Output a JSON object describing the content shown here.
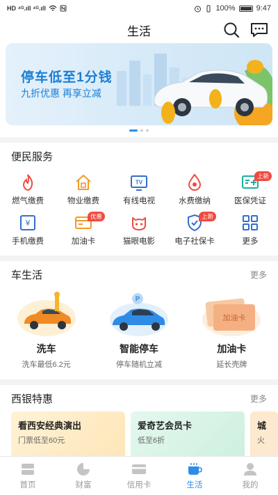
{
  "status_bar": {
    "left_text": "HD ⁴ᴳ.ıll ⁴ᴳ.ıll",
    "battery": "100%",
    "time": "9:47"
  },
  "header": {
    "title": "生活",
    "icons": [
      "search-icon",
      "message-icon"
    ]
  },
  "banner": {
    "title": "停车低至1分钱",
    "subtitle": "九折优惠 再享立减",
    "dots": 3,
    "active_dot": 0
  },
  "services": {
    "title": "便民服务",
    "items": [
      {
        "label": "燃气缴费",
        "icon": "flame-icon",
        "badge": ""
      },
      {
        "label": "物业缴费",
        "icon": "house-icon",
        "badge": ""
      },
      {
        "label": "有线电视",
        "icon": "tv-icon",
        "badge": ""
      },
      {
        "label": "水费缴纳",
        "icon": "water-drop-icon",
        "badge": ""
      },
      {
        "label": "医保凭证",
        "icon": "medical-card-icon",
        "badge": "上新"
      },
      {
        "label": "手机缴费",
        "icon": "phone-icon",
        "badge": ""
      },
      {
        "label": "加油卡",
        "icon": "fuel-card-icon",
        "badge": "优惠"
      },
      {
        "label": "猫眼电影",
        "icon": "cat-icon",
        "badge": ""
      },
      {
        "label": "电子社保卡",
        "icon": "shield-icon",
        "badge": "上新"
      },
      {
        "label": "更多",
        "icon": "grid-icon",
        "badge": ""
      }
    ]
  },
  "car_life": {
    "title": "车生活",
    "more": "更多",
    "cards": [
      {
        "name": "洗车",
        "desc": "洗车最低6.2元",
        "icon": "car-wash-illustration"
      },
      {
        "name": "智能停车",
        "desc": "停车随机立减",
        "icon": "parking-illustration"
      },
      {
        "name": "加油卡",
        "desc": "延长壳牌",
        "icon": "fuel-card-illustration"
      }
    ]
  },
  "xiyin": {
    "title": "西银特惠",
    "more": "更多",
    "cards": [
      {
        "title": "看西安经典演出",
        "sub": "门票低至60元"
      },
      {
        "title": "爱奇艺会员卡",
        "sub": "低至6折"
      },
      {
        "title": "城",
        "sub": "火"
      }
    ]
  },
  "tabbar": {
    "tabs": [
      {
        "label": "首页",
        "icon": "home-icon"
      },
      {
        "label": "财富",
        "icon": "pie-chart-icon"
      },
      {
        "label": "信用卡",
        "icon": "credit-card-icon"
      },
      {
        "label": "生活",
        "icon": "coffee-cup-icon"
      },
      {
        "label": "我的",
        "icon": "user-icon"
      }
    ],
    "active": "生活"
  },
  "colors": {
    "accent": "#2f8ce6",
    "badge": "#f04a3e",
    "banner_text": "#1a7fd6"
  }
}
